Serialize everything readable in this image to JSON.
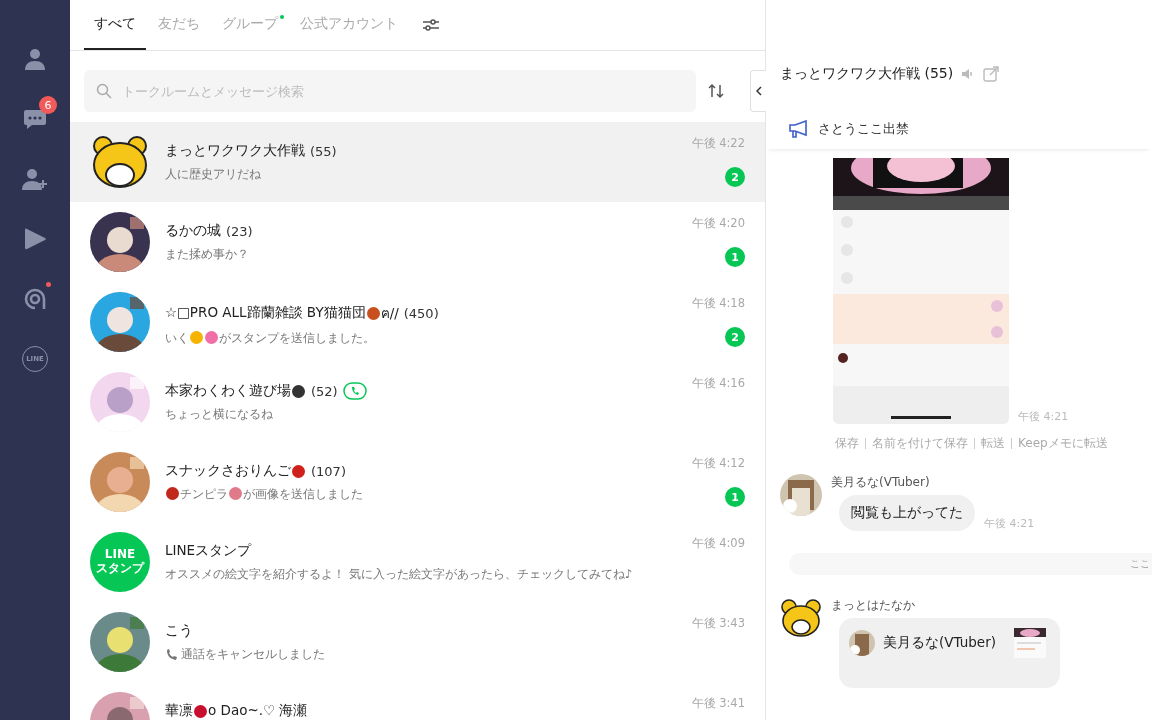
{
  "sidebar": {
    "items": [
      {
        "kind": "friends"
      },
      {
        "kind": "chats",
        "badge": "6"
      },
      {
        "kind": "add-friend"
      },
      {
        "kind": "play"
      },
      {
        "kind": "openchat",
        "dot": true
      },
      {
        "kind": "line",
        "label": "LINE"
      }
    ]
  },
  "tabs": [
    {
      "label": "すべて",
      "selected": true,
      "dot": false
    },
    {
      "label": "友だち",
      "selected": false,
      "dot": false
    },
    {
      "label": "グループ",
      "selected": false,
      "dot": true
    },
    {
      "label": "公式アカウント",
      "selected": false,
      "dot": false
    }
  ],
  "search": {
    "placeholder": "トークルームとメッセージ検索"
  },
  "chats": [
    {
      "avatar": {
        "kind": "bear"
      },
      "name": [
        "まっとワクワク大作戦"
      ],
      "count": "(55)",
      "call": false,
      "preview": [
        "人に歴史アリだね"
      ],
      "time": "午後 4:22",
      "unread": "2",
      "selected": true
    },
    {
      "avatar": {
        "kind": "picture"
      },
      "name": [
        "るかの城"
      ],
      "count": "(23)",
      "call": false,
      "preview": [
        "また揉め事か？"
      ],
      "time": "午後 4:20",
      "unread": "1",
      "selected": false
    },
    {
      "avatar": {
        "kind": "picture"
      },
      "name": [
        "☆□PRO ALL蹄蘭雑談 BY猫猫団",
        {
          "color": "#c8501e"
        },
        "ฅ//"
      ],
      "count": "(450)",
      "call": false,
      "preview": [
        "いく",
        {
          "color": "#f4b400"
        },
        {
          "color": "#f06fa8"
        },
        "がスタンプを送信しました。"
      ],
      "time": "午後 4:18",
      "unread": "2",
      "selected": false
    },
    {
      "avatar": {
        "kind": "picture"
      },
      "name": [
        "本家わくわく遊び場",
        {
          "color": "#333333"
        }
      ],
      "count": "(52)",
      "call": true,
      "preview": [
        "ちょっと横になるね"
      ],
      "time": "午後 4:16",
      "selected": false
    },
    {
      "avatar": {
        "kind": "picture"
      },
      "name": [
        "スナックさおりんご",
        {
          "color": "#d0201c"
        }
      ],
      "count": "(107)",
      "call": false,
      "preview": [
        {
          "color": "#c0281c"
        },
        "チンピラ",
        {
          "color": "#e07a8a"
        },
        "が画像を送信しました"
      ],
      "time": "午後 4:12",
      "unread": "1",
      "selected": false
    },
    {
      "avatar": {
        "kind": "text",
        "lines": [
          "LINE",
          "スタンプ"
        ]
      },
      "name": [
        "LINEスタンプ"
      ],
      "call": false,
      "preview": [
        "オススメの絵文字を紹介するよ！ 気に入った絵文字があったら、チェックしてみてね♪"
      ],
      "time": "午後 4:09",
      "selected": false
    },
    {
      "avatar": {
        "kind": "picture"
      },
      "name": [
        "こう"
      ],
      "call": false,
      "call_log": true,
      "preview": [
        "通話をキャンセルしました"
      ],
      "time": "午後 3:43",
      "selected": false
    },
    {
      "avatar": {
        "kind": "picture"
      },
      "name": [
        "華凛",
        {
          "color": "#c8102e"
        },
        "o Dao~.♡ 海瀬"
      ],
      "call": false,
      "time": "午後 3:41",
      "selected": false
    }
  ],
  "chat": {
    "title": "まっとワクワク大作戦 (55)",
    "announcement": "さとうここ出禁",
    "messages": [
      {
        "time": "午後 4:21",
        "actions": [
          "保存",
          "名前を付けて保存",
          "転送",
          "Keepメモに転送"
        ]
      },
      {
        "kind": "text",
        "sender": "美月るな(VTuber)",
        "text": "閲覧も上がってた",
        "time": "午後 4:21"
      },
      {
        "kind": "divider",
        "text": "ここ"
      },
      {
        "kind": "reply",
        "sender": "まっとはたなか",
        "quoted_sender": "美月るな(VTuber)"
      }
    ]
  }
}
